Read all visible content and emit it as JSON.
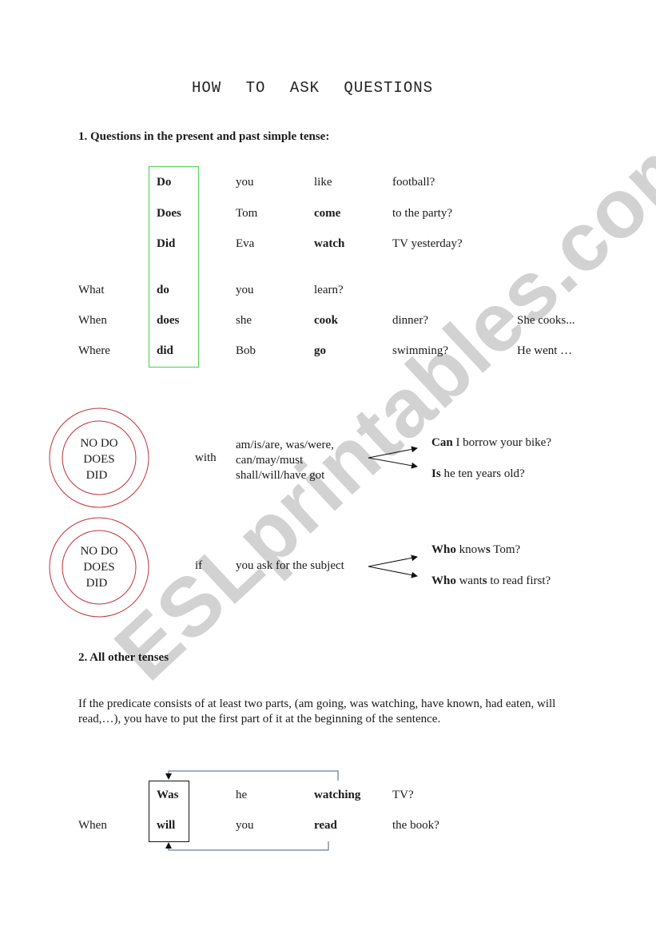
{
  "document": {
    "title": "HOW TO ASK QUESTIONS",
    "watermark": "ESLprintables.com",
    "colors": {
      "green_box": "#5fd35f",
      "circles": "#c0303a",
      "loop_arrow": "#4a5a9a",
      "watermark": "#d2d2d2"
    }
  },
  "section1": {
    "heading": "1. Questions in the present and past simple tense:",
    "rows": [
      {
        "wh": "",
        "aux": "Do",
        "subject": "you",
        "verb": "like",
        "verb_bold": false,
        "rest": "football?",
        "answer": ""
      },
      {
        "wh": "",
        "aux": "Does",
        "subject": "Tom",
        "verb": "come",
        "verb_bold": true,
        "rest": "to the party?",
        "answer": ""
      },
      {
        "wh": "",
        "aux": "Did",
        "subject": "Eva",
        "verb": "watch",
        "verb_bold": true,
        "rest": "TV yesterday?",
        "answer": ""
      },
      {
        "wh": "What",
        "aux": "do",
        "subject": "you",
        "verb": "learn?",
        "verb_bold": false,
        "rest": "",
        "answer": ""
      },
      {
        "wh": "When",
        "aux": "does",
        "subject": "she",
        "verb": "cook",
        "verb_bold": true,
        "rest": "dinner?",
        "answer": "She cooks..."
      },
      {
        "wh": "Where",
        "aux": "did",
        "subject": "Bob",
        "verb": "go",
        "verb_bold": true,
        "rest": "swimming?",
        "answer": "He went …"
      }
    ]
  },
  "rule_no_do_1": {
    "circle_lines": [
      "NO  DO",
      "DOES",
      "DID"
    ],
    "connector": "with",
    "verbs_lines": [
      "am/is/are, was/were,",
      "can/may/must",
      "shall/will/have got"
    ],
    "examples": [
      {
        "bold": "Can",
        "rest": " I borrow your bike?"
      },
      {
        "bold": "Is",
        "rest": " he ten years old?"
      }
    ]
  },
  "rule_no_do_2": {
    "circle_lines": [
      "NO  DO",
      "DOES",
      "DID"
    ],
    "connector": "if",
    "condition": "you ask for the subject",
    "examples": [
      {
        "bold": "Who",
        "mid": " know",
        "bold_s": "s",
        "rest": " Tom?"
      },
      {
        "bold": "Who",
        "mid": " want",
        "bold_s": "s",
        "rest": " to read first?"
      }
    ]
  },
  "section2": {
    "heading": "2. All other tenses",
    "paragraph": "If the predicate consists of at least two parts, (am going, was watching, have known, had eaten, will read,…), you have to put the first part of it at the beginning of the sentence.",
    "rows": [
      {
        "wh": "",
        "aux": "Was",
        "subject": "he",
        "verb": "watching",
        "rest": "TV?"
      },
      {
        "wh": "When",
        "aux": "will",
        "subject": "you",
        "verb": "read",
        "rest": "the book?"
      }
    ]
  }
}
